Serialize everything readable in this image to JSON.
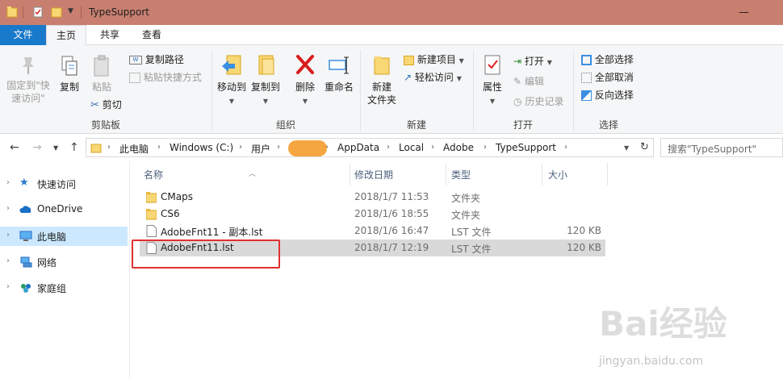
{
  "window": {
    "title": "TypeSupport"
  },
  "tabs": {
    "file": "文件",
    "home": "主页",
    "share": "共享",
    "view": "查看"
  },
  "ribbon": {
    "clipboard": {
      "group_label": "剪贴板",
      "pin_quick_access": "固定到\"快\n速访问\"",
      "pin_line1": "固定到\"快",
      "pin_line2": "速访问\"",
      "copy": "复制",
      "paste": "粘贴",
      "copy_path": "复制路径",
      "paste_shortcut": "粘贴快捷方式",
      "cut": "剪切"
    },
    "organize": {
      "group_label": "组织",
      "move_to": "移动到",
      "copy_to": "复制到",
      "delete": "删除",
      "rename": "重命名"
    },
    "new": {
      "group_label": "新建",
      "new_folder_line1": "新建",
      "new_folder_line2": "文件夹",
      "new_item": "新建项目",
      "easy_access": "轻松访问"
    },
    "open": {
      "group_label": "打开",
      "properties": "属性",
      "open": "打开",
      "edit": "编辑",
      "history": "历史记录"
    },
    "select": {
      "group_label": "选择",
      "select_all": "全部选择",
      "select_none": "全部取消",
      "invert_selection": "反向选择"
    }
  },
  "address": {
    "crumbs": [
      "此电脑",
      "Windows (C:)",
      "用户",
      "AppData",
      "Local",
      "Adobe",
      "TypeSupport"
    ],
    "search_placeholder": "搜索\"TypeSupport\""
  },
  "nav": {
    "items": [
      {
        "label": "快速访问"
      },
      {
        "label": "OneDrive"
      },
      {
        "label": "此电脑"
      },
      {
        "label": "网络"
      },
      {
        "label": "家庭组"
      }
    ]
  },
  "files": {
    "columns": {
      "name": "名称",
      "modified": "修改日期",
      "type": "类型",
      "size": "大小"
    },
    "rows": [
      {
        "name": "CMaps",
        "modified": "2018/1/7 11:53",
        "type": "文件夹",
        "size": ""
      },
      {
        "name": "CS6",
        "modified": "2018/1/6 18:55",
        "type": "文件夹",
        "size": ""
      },
      {
        "name": "AdobeFnt11 - 副本.lst",
        "modified": "2018/1/6 16:47",
        "type": "LST 文件",
        "size": "120 KB"
      },
      {
        "name": "AdobeFnt11.lst",
        "modified": "2018/1/7 12:19",
        "type": "LST 文件",
        "size": "120 KB"
      }
    ]
  },
  "watermark": {
    "brand": "Bai经验",
    "url": "jingyan.baidu.com"
  },
  "colors": {
    "accent": "#1979ca",
    "titlebar": "#c87f70",
    "selection": "#cce8ff",
    "highlight": "#e03030"
  }
}
